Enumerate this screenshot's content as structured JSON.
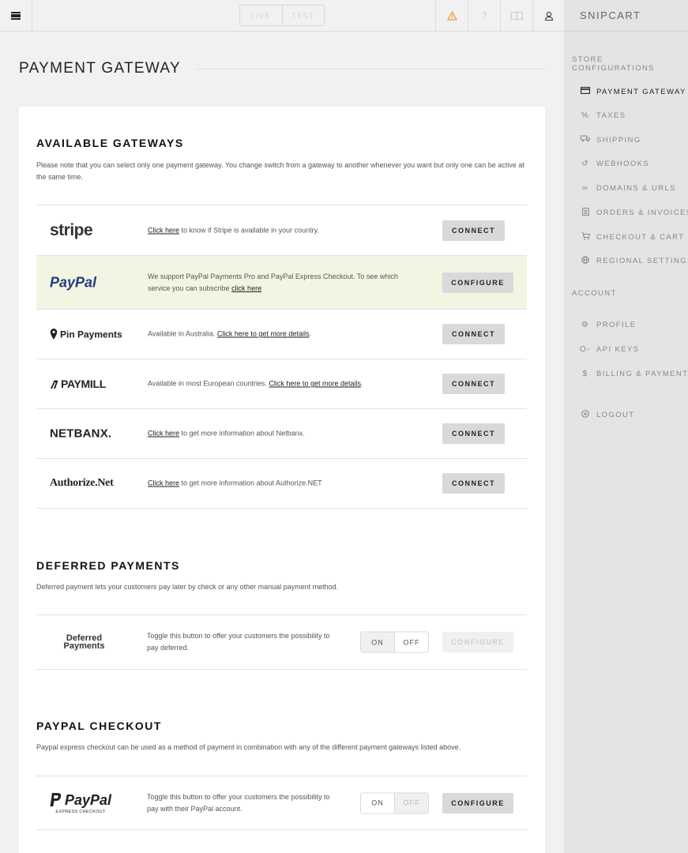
{
  "topbar": {
    "mode_live": "LIVE",
    "mode_test": "TEST",
    "icons": [
      "hamburger-menu-icon",
      "warning-icon",
      "help-icon",
      "docs-book-icon",
      "user-icon"
    ],
    "warning_color": "#f0a040"
  },
  "sidebar": {
    "brand": "SNIPCART",
    "section_store": "STORE CONFIGURATIONS",
    "store_items": [
      {
        "label": "PAYMENT GATEWAY",
        "icon": "credit-card-icon"
      },
      {
        "label": "TAXES",
        "icon": "percent-icon"
      },
      {
        "label": "SHIPPING",
        "icon": "truck-icon"
      },
      {
        "label": "WEBHOOKS",
        "icon": "hook-icon"
      },
      {
        "label": "DOMAINS & URLS",
        "icon": "link-icon"
      },
      {
        "label": "ORDERS & INVOICES",
        "icon": "document-icon"
      },
      {
        "label": "CHECKOUT & CART",
        "icon": "cart-icon"
      },
      {
        "label": "REGIONAL SETTINGS",
        "icon": "globe-icon"
      }
    ],
    "section_account": "ACCOUNT",
    "account_items": [
      {
        "label": "PROFILE",
        "icon": "gear-icon"
      },
      {
        "label": "API KEYS",
        "icon": "key-icon"
      },
      {
        "label": "BILLING & PAYMENTS",
        "icon": "dollar-icon"
      }
    ],
    "logout": "LOGOUT"
  },
  "main": {
    "title": "PAYMENT GATEWAY",
    "gateways": {
      "title": "AVAILABLE GATEWAYS",
      "desc": "Please note that you can select only one payment gateway. You change switch from a gateway to another whenever you want but only one can be active at the same time.",
      "rows": [
        {
          "logo": "stripe",
          "link": "Click here",
          "text": " to know if Stripe is available in your country.",
          "button": "CONNECT"
        },
        {
          "logo": "PayPal",
          "text": "We support PayPal Payments Pro and PayPal Express Checkout. To see which service you can subscribe ",
          "link": "click here",
          "button": "CONFIGURE"
        },
        {
          "logo": "Pin Payments",
          "text": "Available in Australia. ",
          "link": "Click here to get more details",
          "text2": ".",
          "button": "CONNECT"
        },
        {
          "logo": "PAYMILL",
          "text": "Available in most European countries. ",
          "link": "Click here to get more details",
          "text2": ".",
          "button": "CONNECT"
        },
        {
          "logo": "NETBANX.",
          "link": "Click here",
          "text": " to get more information about Netbanx.",
          "button": "CONNECT"
        },
        {
          "logo": "Authorize.Net",
          "link": "Click here",
          "text": " to get more information about Authorize.NET",
          "button": "CONNECT"
        }
      ]
    },
    "deferred": {
      "title": "DEFERRED PAYMENTS",
      "desc": "Deferred payment lets your customers pay later by check or any other manual payment method.",
      "logo_line1": "Deferred",
      "logo_line2": "Payments",
      "text": "Toggle this button to offer your customers the possibility to pay deferred.",
      "on": "ON",
      "off": "OFF",
      "state": "OFF",
      "button": "CONFIGURE"
    },
    "paypal_checkout": {
      "title": "PAYPAL CHECKOUT",
      "desc": "Paypal express checkout can be used as a method of payment in combination with any of the different payment gateways listed above.",
      "logo": "PayPal",
      "logo_sub": "EXPRESS CHECKOUT",
      "text": "Toggle this button to offer your customers the possibility to pay with their PayPal account.",
      "on": "ON",
      "off": "OFF",
      "state": "ON",
      "button": "CONFIGURE"
    }
  },
  "colors": {
    "highlight_row": "#f4f4e3",
    "sidebar_bg": "#e4e4e4",
    "button_bg": "#d9d9d9"
  }
}
